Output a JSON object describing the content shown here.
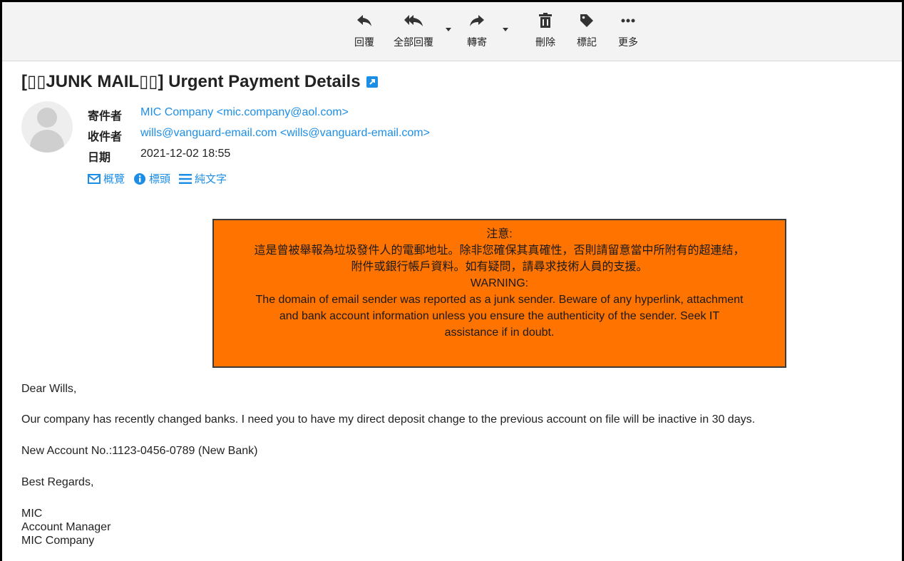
{
  "toolbar": {
    "reply": "回覆",
    "reply_all": "全部回覆",
    "forward": "轉寄",
    "delete": "刪除",
    "tag": "標記",
    "more": "更多"
  },
  "message": {
    "subject": "[▯▯JUNK MAIL▯▯] Urgent Payment Details",
    "from_label": "寄件者",
    "from": "MIC Company <mic.company@aol.com>",
    "to_label": "收件者",
    "to": "wills@vanguard-email.com <wills@vanguard-email.com>",
    "date_label": "日期",
    "date": "2021-12-02 18:55"
  },
  "view": {
    "summary": "概覽",
    "headers": "標頭",
    "plain": "純文字"
  },
  "warning": {
    "title_zh": "注意:",
    "line_zh_1": "這是曾被舉報為垃圾發件人的電郵地址。除非您確保其真確性，否則請留意當中所附有的超連結，",
    "line_zh_2": "附件或銀行帳戶資料。如有疑問，請尋求技術人員的支援。",
    "title_en": "WARNING:",
    "line_en_1": "The domain of email sender was reported as a junk sender.  Beware of any hyperlink, attachment",
    "line_en_2": "and bank account information unless you ensure the authenticity of the sender.  Seek IT",
    "line_en_3": "assistance if in doubt.",
    "color": "#ff7300"
  },
  "body": {
    "greeting": "Dear Wills,",
    "paragraph": "Our company has recently changed banks. I need you to have my direct deposit change to the previous account on file will be inactive in 30 days.",
    "account": "New Account No.:1123-0456-0789 (New Bank)",
    "closing": "Best Regards,",
    "sig_name": "MIC",
    "sig_title": "Account Manager",
    "sig_company": "MIC Company"
  },
  "colors": {
    "link": "#1d8ee6",
    "toolbar_bg": "#f3f3f3"
  }
}
